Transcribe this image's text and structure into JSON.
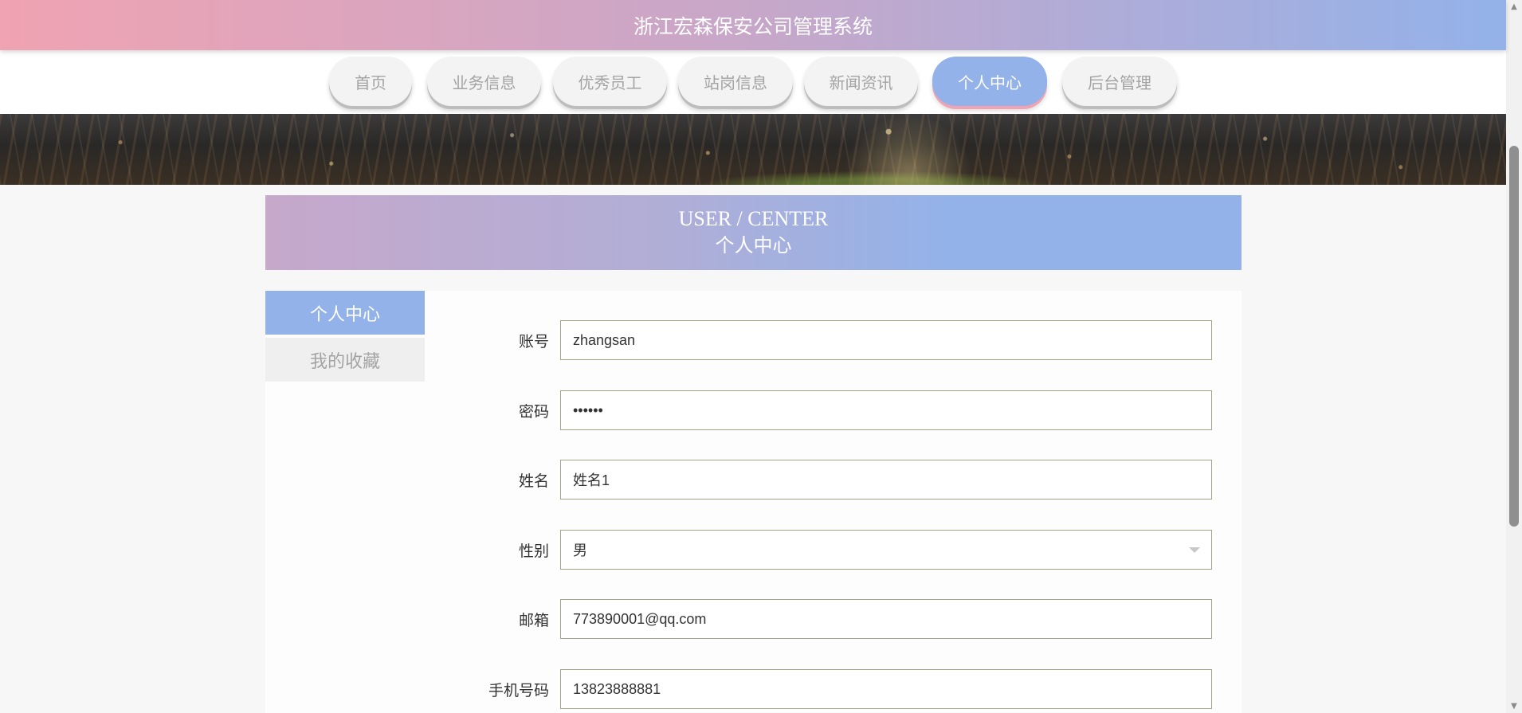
{
  "header": {
    "title": "浙江宏森保安公司管理系统"
  },
  "nav": {
    "items": [
      {
        "label": "首页"
      },
      {
        "label": "业务信息"
      },
      {
        "label": "优秀员工"
      },
      {
        "label": "站岗信息"
      },
      {
        "label": "新闻资讯"
      },
      {
        "label": "个人中心",
        "active": true
      },
      {
        "label": "后台管理"
      }
    ]
  },
  "section": {
    "title_en": "USER / CENTER",
    "title_zh": "个人中心"
  },
  "sidebar": {
    "items": [
      {
        "label": "个人中心",
        "active": true
      },
      {
        "label": "我的收藏",
        "active": false
      }
    ]
  },
  "form": {
    "account": {
      "label": "账号",
      "value": "zhangsan"
    },
    "password": {
      "label": "密码",
      "value": "••••••"
    },
    "name": {
      "label": "姓名",
      "value": "姓名1"
    },
    "gender": {
      "label": "性别",
      "value": "男"
    },
    "email": {
      "label": "邮箱",
      "value": "773890001@qq.com"
    },
    "phone": {
      "label": "手机号码",
      "value": "13823888881"
    }
  },
  "colors": {
    "accent_blue": "#93b2e9",
    "accent_pink": "#f0a3b2",
    "accent_purple": "#c6a8cb",
    "inactive_text": "#a3a3a3"
  },
  "icons": {
    "select_caret": "chevron-down-icon",
    "scroll_up": "arrow-up-icon",
    "scroll_down": "arrow-down-icon"
  }
}
